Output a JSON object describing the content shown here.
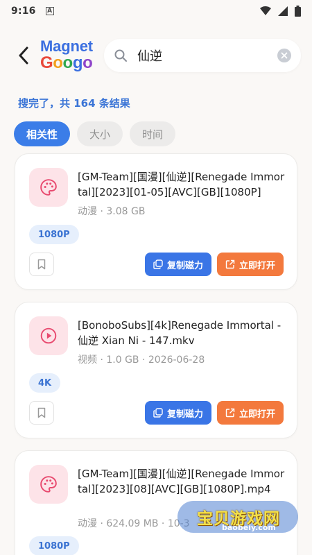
{
  "status_bar": {
    "time": "9:16",
    "notification_letter": "A"
  },
  "header": {
    "logo_line1": "Magnet",
    "logo_line2": "Googo",
    "search_query": "仙逆"
  },
  "result_count": "搜完了，共 164 条结果",
  "tabs": [
    {
      "label": "相关性",
      "active": true
    },
    {
      "label": "大小",
      "active": false
    },
    {
      "label": "时间",
      "active": false
    }
  ],
  "results": [
    {
      "icon": "palette-icon",
      "title": "[GM-Team][国漫][仙逆][Renegade Immortal][2023][01-05][AVC][GB][1080P]",
      "meta": "动漫 · 3.08 GB",
      "tag": "1080P",
      "copy_label": "复制磁力",
      "open_label": "立即打开"
    },
    {
      "icon": "play-circle-icon",
      "title": "[BonoboSubs][4k]Renegade Immortal - 仙逆 Xian Ni - 147.mkv",
      "meta": "视频 · 1.0 GB · 2026-06-28",
      "tag": "4K",
      "copy_label": "复制磁力",
      "open_label": "立即打开"
    },
    {
      "icon": "palette-icon",
      "title": "[GM-Team][国漫][仙逆][Renegade Immortal][2023][08][AVC][GB][1080P].mp4",
      "meta": "动漫 · 624.09 MB · 10-3",
      "tag": "1080P"
    }
  ],
  "watermark": {
    "text": "宝贝游戏网",
    "url": "baobeiy.com"
  },
  "colors": {
    "accent": "#3b7de8",
    "orange": "#f3793d",
    "icon_bg": "#fde3e8",
    "icon_fg": "#e84a6f"
  }
}
